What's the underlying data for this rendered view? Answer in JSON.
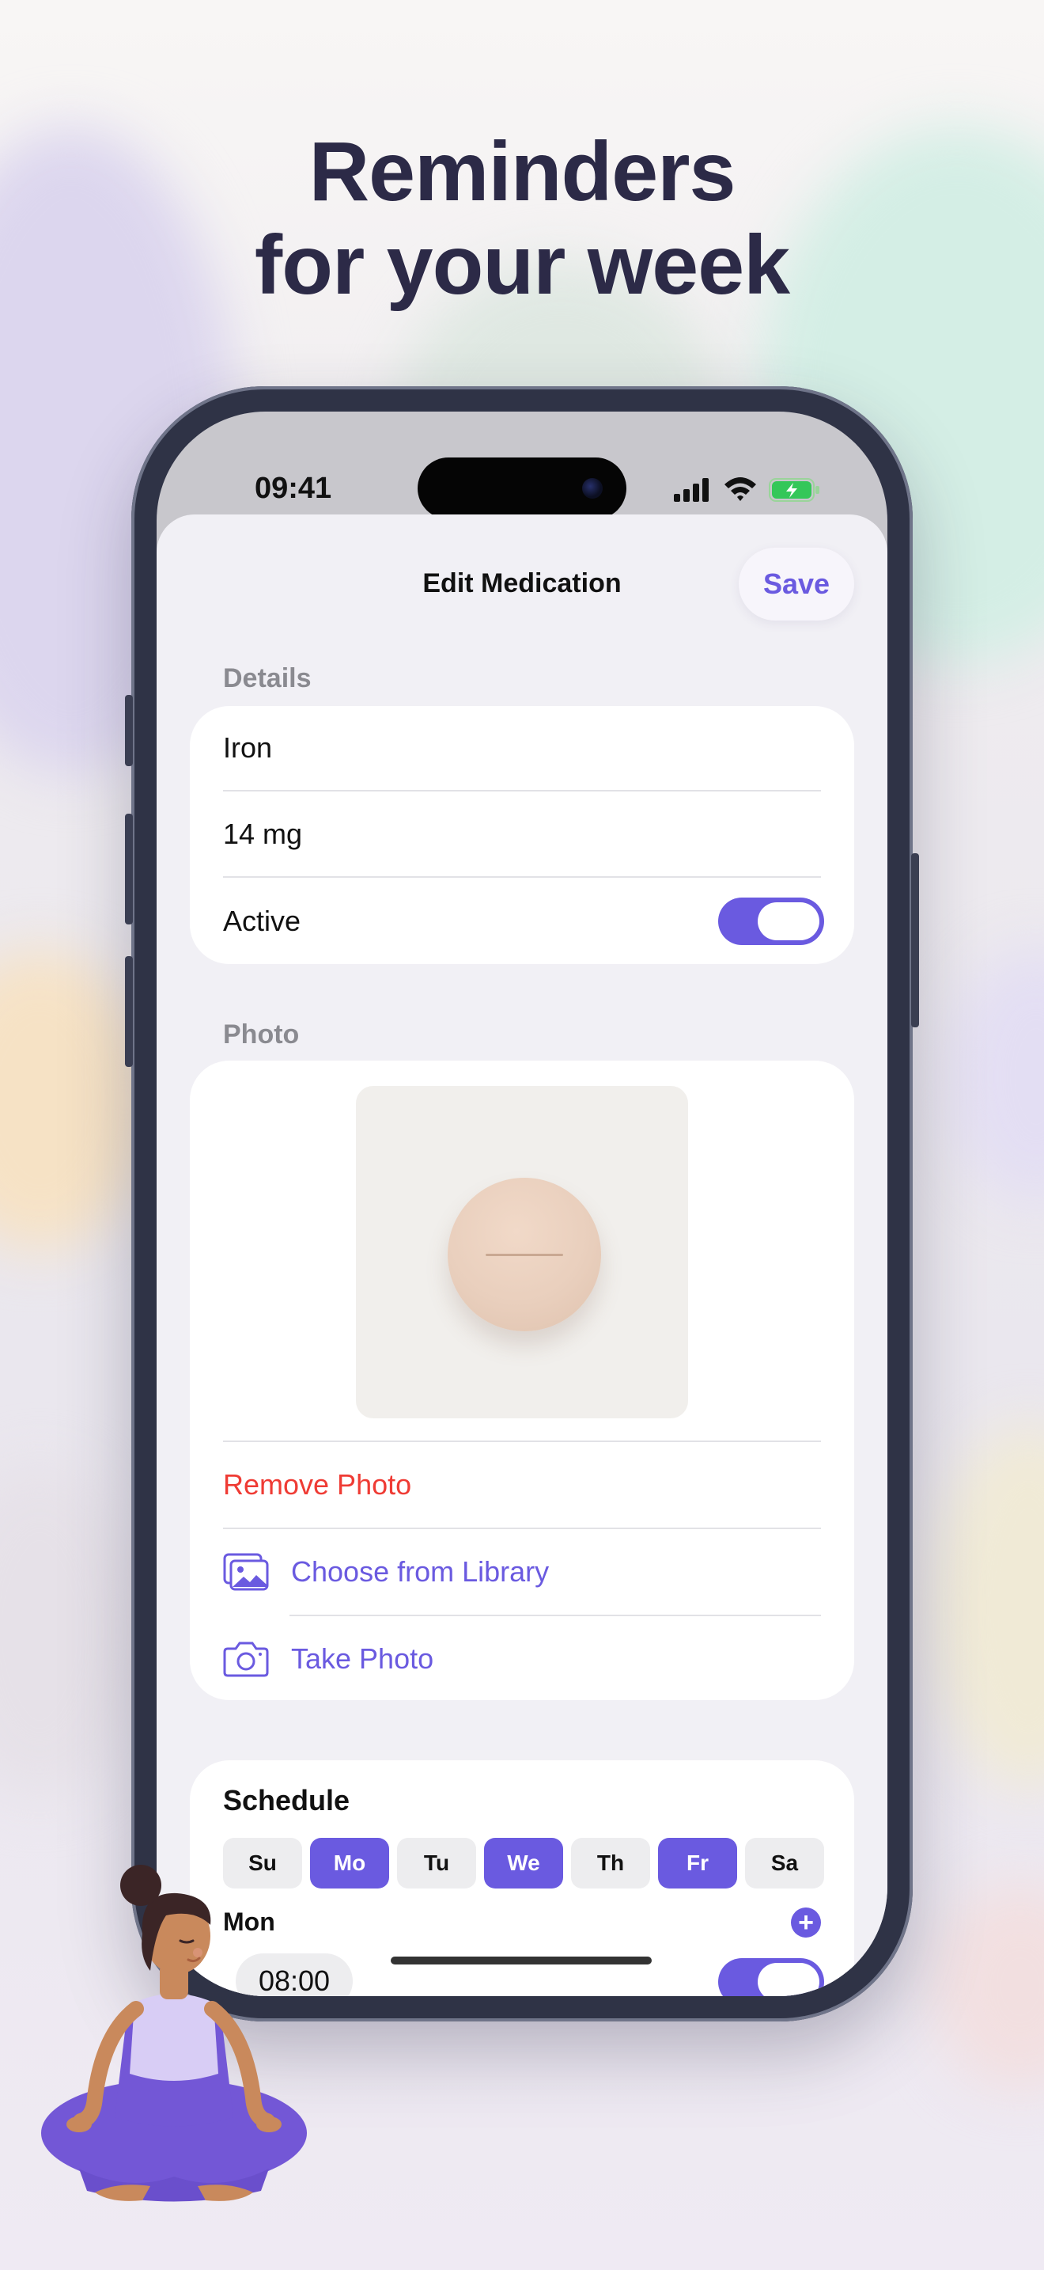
{
  "headline": {
    "line1": "Reminders",
    "line2": "for your week"
  },
  "status_bar": {
    "time": "09:41"
  },
  "nav": {
    "title": "Edit Medication",
    "save_label": "Save"
  },
  "details": {
    "section_label": "Details",
    "name": "Iron",
    "dose": "14 mg",
    "active_label": "Active",
    "active_on": true
  },
  "photo": {
    "section_label": "Photo",
    "remove_label": "Remove Photo",
    "library_label": "Choose from Library",
    "take_label": "Take Photo"
  },
  "schedule": {
    "title": "Schedule",
    "days": [
      {
        "label": "Su",
        "selected": false
      },
      {
        "label": "Mo",
        "selected": true
      },
      {
        "label": "Tu",
        "selected": false
      },
      {
        "label": "We",
        "selected": true
      },
      {
        "label": "Th",
        "selected": false
      },
      {
        "label": "Fr",
        "selected": true
      },
      {
        "label": "Sa",
        "selected": false
      }
    ],
    "day_heading": "Mon",
    "time_value": "08:00",
    "reminder_on": true
  },
  "colors": {
    "accent": "#6a5ae0",
    "destructive": "#ef3b34",
    "headline": "#2c2a47"
  },
  "icons": [
    "photo-library-icon",
    "camera-icon",
    "plus-icon",
    "signal-icon",
    "wifi-icon",
    "battery-icon"
  ]
}
